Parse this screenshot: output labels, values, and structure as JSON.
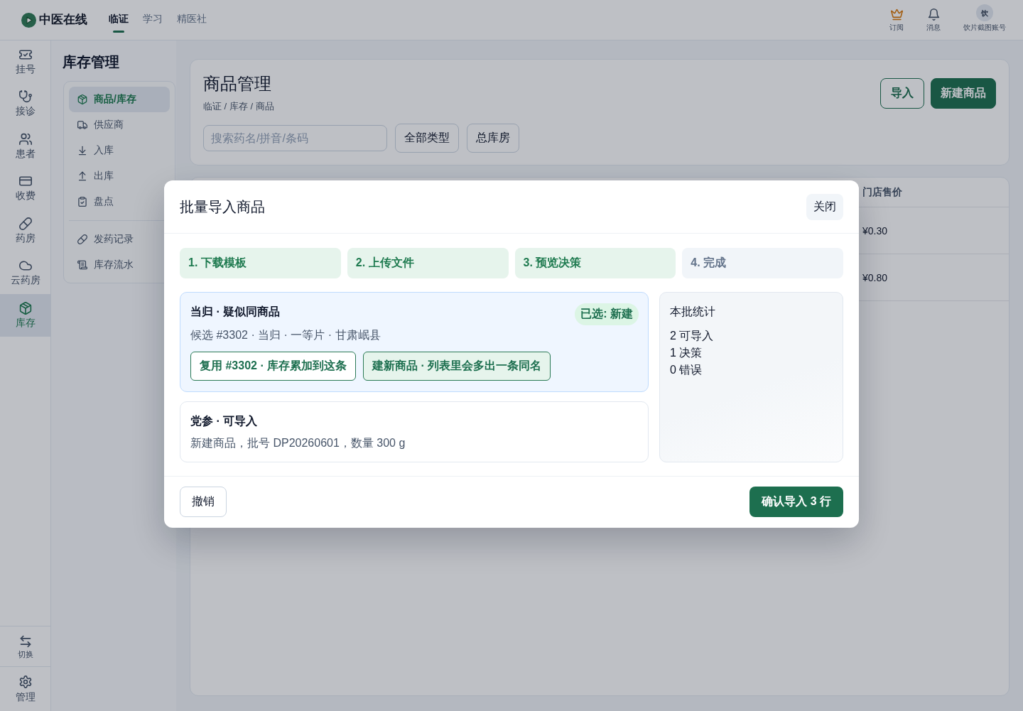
{
  "top_bar": {
    "app_name": "中医在线",
    "nav": [
      {
        "label": "临证",
        "selected": true
      },
      {
        "label": "学习",
        "selected": false
      },
      {
        "label": "精医社",
        "selected": false
      }
    ],
    "actions": [
      {
        "label": "订阅"
      },
      {
        "label": "消息"
      }
    ],
    "account": {
      "avatar": "饮",
      "name": "饮片截图账号"
    }
  },
  "rail": {
    "items": [
      {
        "label": "挂号",
        "selected": false
      },
      {
        "label": "接诊",
        "selected": false
      },
      {
        "label": "患者",
        "selected": false
      },
      {
        "label": "收费",
        "selected": false
      },
      {
        "label": "药房",
        "selected": false
      },
      {
        "label": "云药房",
        "selected": false
      },
      {
        "label": "库存",
        "selected": true
      }
    ],
    "bottom_items": [
      {
        "label": "切换"
      },
      {
        "label": "管理"
      }
    ]
  },
  "section_nav": {
    "title": "库存管理",
    "groups": [
      {
        "items": [
          {
            "label": "商品/库存",
            "selected": true
          },
          {
            "label": "供应商",
            "selected": false
          },
          {
            "label": "入库",
            "selected": false
          },
          {
            "label": "出库",
            "selected": false
          },
          {
            "label": "盘点",
            "selected": false
          }
        ]
      },
      {
        "items": [
          {
            "label": "发药记录",
            "selected": false
          },
          {
            "label": "库存流水",
            "selected": false
          }
        ]
      }
    ]
  },
  "page_header": {
    "title": "商品管理",
    "breadcrumb": "临证 / 库存 / 商品",
    "search": {
      "placeholder": "搜索药名/拼音/条码"
    },
    "filters": [
      "全部类型",
      "总库房"
    ],
    "buttons": [
      {
        "label": "导入",
        "kind": "outline"
      },
      {
        "label": "新建商品",
        "kind": "primary"
      }
    ]
  },
  "table": {
    "columns": [
      "门店售价"
    ],
    "rows": [
      [
        "¥0.30"
      ],
      [
        "¥0.80"
      ]
    ]
  },
  "dialog": {
    "title": "批量导入商品",
    "close": "关闭",
    "steps": [
      {
        "label": "1. 下载模板",
        "reached": true
      },
      {
        "label": "2. 上传文件",
        "reached": true
      },
      {
        "label": "3. 预览决策",
        "reached": true
      },
      {
        "label": "4. 完成",
        "reached": false
      }
    ],
    "rows": [
      {
        "kind": "decision",
        "title": "当归 · 疑似同商品",
        "badge": "已选: 新建",
        "detail": "候选 #3302 · 当归 · 一等片 · 甘肃岷县",
        "options": [
          {
            "label": "复用 #3302 · 库存累加到这条",
            "selected": false
          },
          {
            "label": "建新商品 · 列表里会多出一条同名",
            "selected": true
          }
        ]
      },
      {
        "kind": "ready",
        "title": "党参 · 可导入",
        "detail": "新建商品，批号 DP20260601，数量 300 g"
      }
    ],
    "summary": {
      "title": "本批统计",
      "lines": [
        "2 可导入",
        "1 决策",
        "0 错误"
      ]
    },
    "cancel": "撤销",
    "confirm": "确认导入 3 行"
  }
}
